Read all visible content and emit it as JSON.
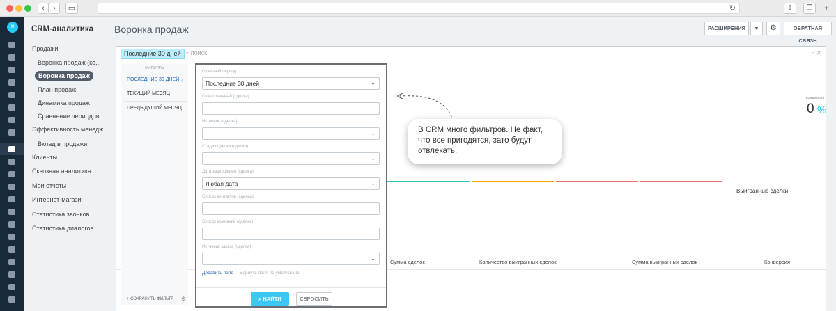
{
  "app": {
    "title": "CRM-аналитика",
    "page_title": "Воронка продаж"
  },
  "sidebar": {
    "items": [
      {
        "label": "Продажи",
        "level": 0,
        "active": false
      },
      {
        "label": "Воронка продаж (ко...",
        "level": 1,
        "active": false
      },
      {
        "label": "Воронка продаж",
        "level": 1,
        "active": true
      },
      {
        "label": "План продаж",
        "level": 1,
        "active": false
      },
      {
        "label": "Динамика продаж",
        "level": 1,
        "active": false
      },
      {
        "label": "Сравнение периодов",
        "level": 1,
        "active": false
      },
      {
        "label": "Эффективность менедж...",
        "level": 0,
        "active": false
      },
      {
        "label": "Вклад в продажи",
        "level": 1,
        "active": false
      },
      {
        "label": "Клиенты",
        "level": 0,
        "active": false
      },
      {
        "label": "Сквозная аналитика",
        "level": 0,
        "active": false
      },
      {
        "label": "Мои отчеты",
        "level": 0,
        "active": false
      },
      {
        "label": "Интернет-магазин",
        "level": 0,
        "active": false
      },
      {
        "label": "Статистика звонков",
        "level": 0,
        "active": false
      },
      {
        "label": "Статистика диалогов",
        "level": 0,
        "active": false
      }
    ]
  },
  "header": {
    "extensions_label": "РАСШИРЕНИЯ",
    "feedback_label": "ОБРАТНАЯ СВЯЗЬ"
  },
  "filter_bar": {
    "active_chip": "Последние 30 дней",
    "search_placeholder": "+ поиск"
  },
  "presets": {
    "header": "ФИЛЬТРЫ",
    "items": [
      "ПОСЛЕДНИЕ 30 ДНЕЙ",
      "ТЕКУЩИЙ МЕСЯЦ",
      "ПРЕДЫДУЩИЙ МЕСЯЦ"
    ],
    "save_filter_label": "+ СОХРАНИТЬ ФИЛЬТР"
  },
  "filter_form": {
    "fields": [
      {
        "label": "Отчетный период",
        "value": "Последние 30 дней",
        "dropdown": true
      },
      {
        "label": "Ответственный (сделка)",
        "value": "",
        "dropdown": false
      },
      {
        "label": "Источник (сделка)",
        "value": "",
        "dropdown": true
      },
      {
        "label": "Стадия сделки (сделка)",
        "value": "",
        "dropdown": true
      },
      {
        "label": "Дата завершения (сделка)",
        "value": "Любая дата",
        "dropdown": true
      },
      {
        "label": "Список контактов (сделка)",
        "value": "",
        "dropdown": false
      },
      {
        "label": "Список компаний (сделка)",
        "value": "",
        "dropdown": false
      },
      {
        "label": "Источник заказа (сделка)",
        "value": "",
        "dropdown": true
      }
    ],
    "add_field_label": "Добавить поле",
    "restore_fields_label": "Вернуть поля по умолчанию",
    "find_label": "НАЙТИ",
    "reset_label": "СБРОСИТЬ"
  },
  "stats": {
    "conversion_label": "конверсия",
    "conversion_value": "0",
    "conversion_unit": "%",
    "won_deals_label": "Выигранные сделки",
    "columns": [
      "Сумма сделок",
      "Количество выигранных сделок",
      "Сумма выигранных сделок",
      "Конверсия"
    ],
    "bar_colors": [
      "#2fc6c1",
      "#f7a700",
      "#f26d6d",
      "#f26d6d"
    ]
  },
  "callout": {
    "text": "В CRM много фильтров. Не факт, что все пригодятся, зато  будут отвлекать."
  },
  "colors": {
    "accent": "#2fc6f6",
    "rail": "#18293a",
    "active_item": "#535c69"
  }
}
